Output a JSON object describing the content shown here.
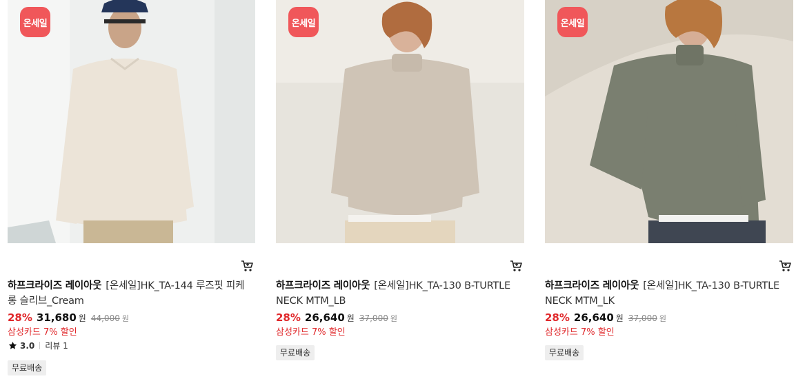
{
  "products": [
    {
      "badge": "온세일",
      "brand": "하프크라이즈 레이아웃",
      "name": "[온세일]HK_TA-144 루즈핏 피케 롱 슬리브_Cream",
      "discount_rate": "28%",
      "price": "31,680",
      "currency": "원",
      "original_price": "44,000",
      "original_currency": "원",
      "card_discount": "삼성카드 7% 할인",
      "rating": "3.0",
      "review_text": "리뷰 1",
      "shipping": "무료배송",
      "sweater_color": "#ece4d8",
      "bg_color": "#eef0ef"
    },
    {
      "badge": "온세일",
      "brand": "하프크라이즈 레이아웃",
      "name": "[온세일]HK_TA-130 B-TURTLE NECK MTM_LB",
      "discount_rate": "28%",
      "price": "26,640",
      "currency": "원",
      "original_price": "37,000",
      "original_currency": "원",
      "card_discount": "삼성카드 7% 할인",
      "shipping": "무료배송",
      "sweater_color": "#cfc4b6",
      "bg_color": "#e7e4dd"
    },
    {
      "badge": "온세일",
      "brand": "하프크라이즈 레이아웃",
      "name": "[온세일]HK_TA-130 B-TURTLE NECK MTM_LK",
      "discount_rate": "28%",
      "price": "26,640",
      "currency": "원",
      "original_price": "37,000",
      "original_currency": "원",
      "card_discount": "삼성카드 7% 할인",
      "shipping": "무료배송",
      "sweater_color": "#7a7f70",
      "bg_color": "#e3ddd3"
    }
  ]
}
